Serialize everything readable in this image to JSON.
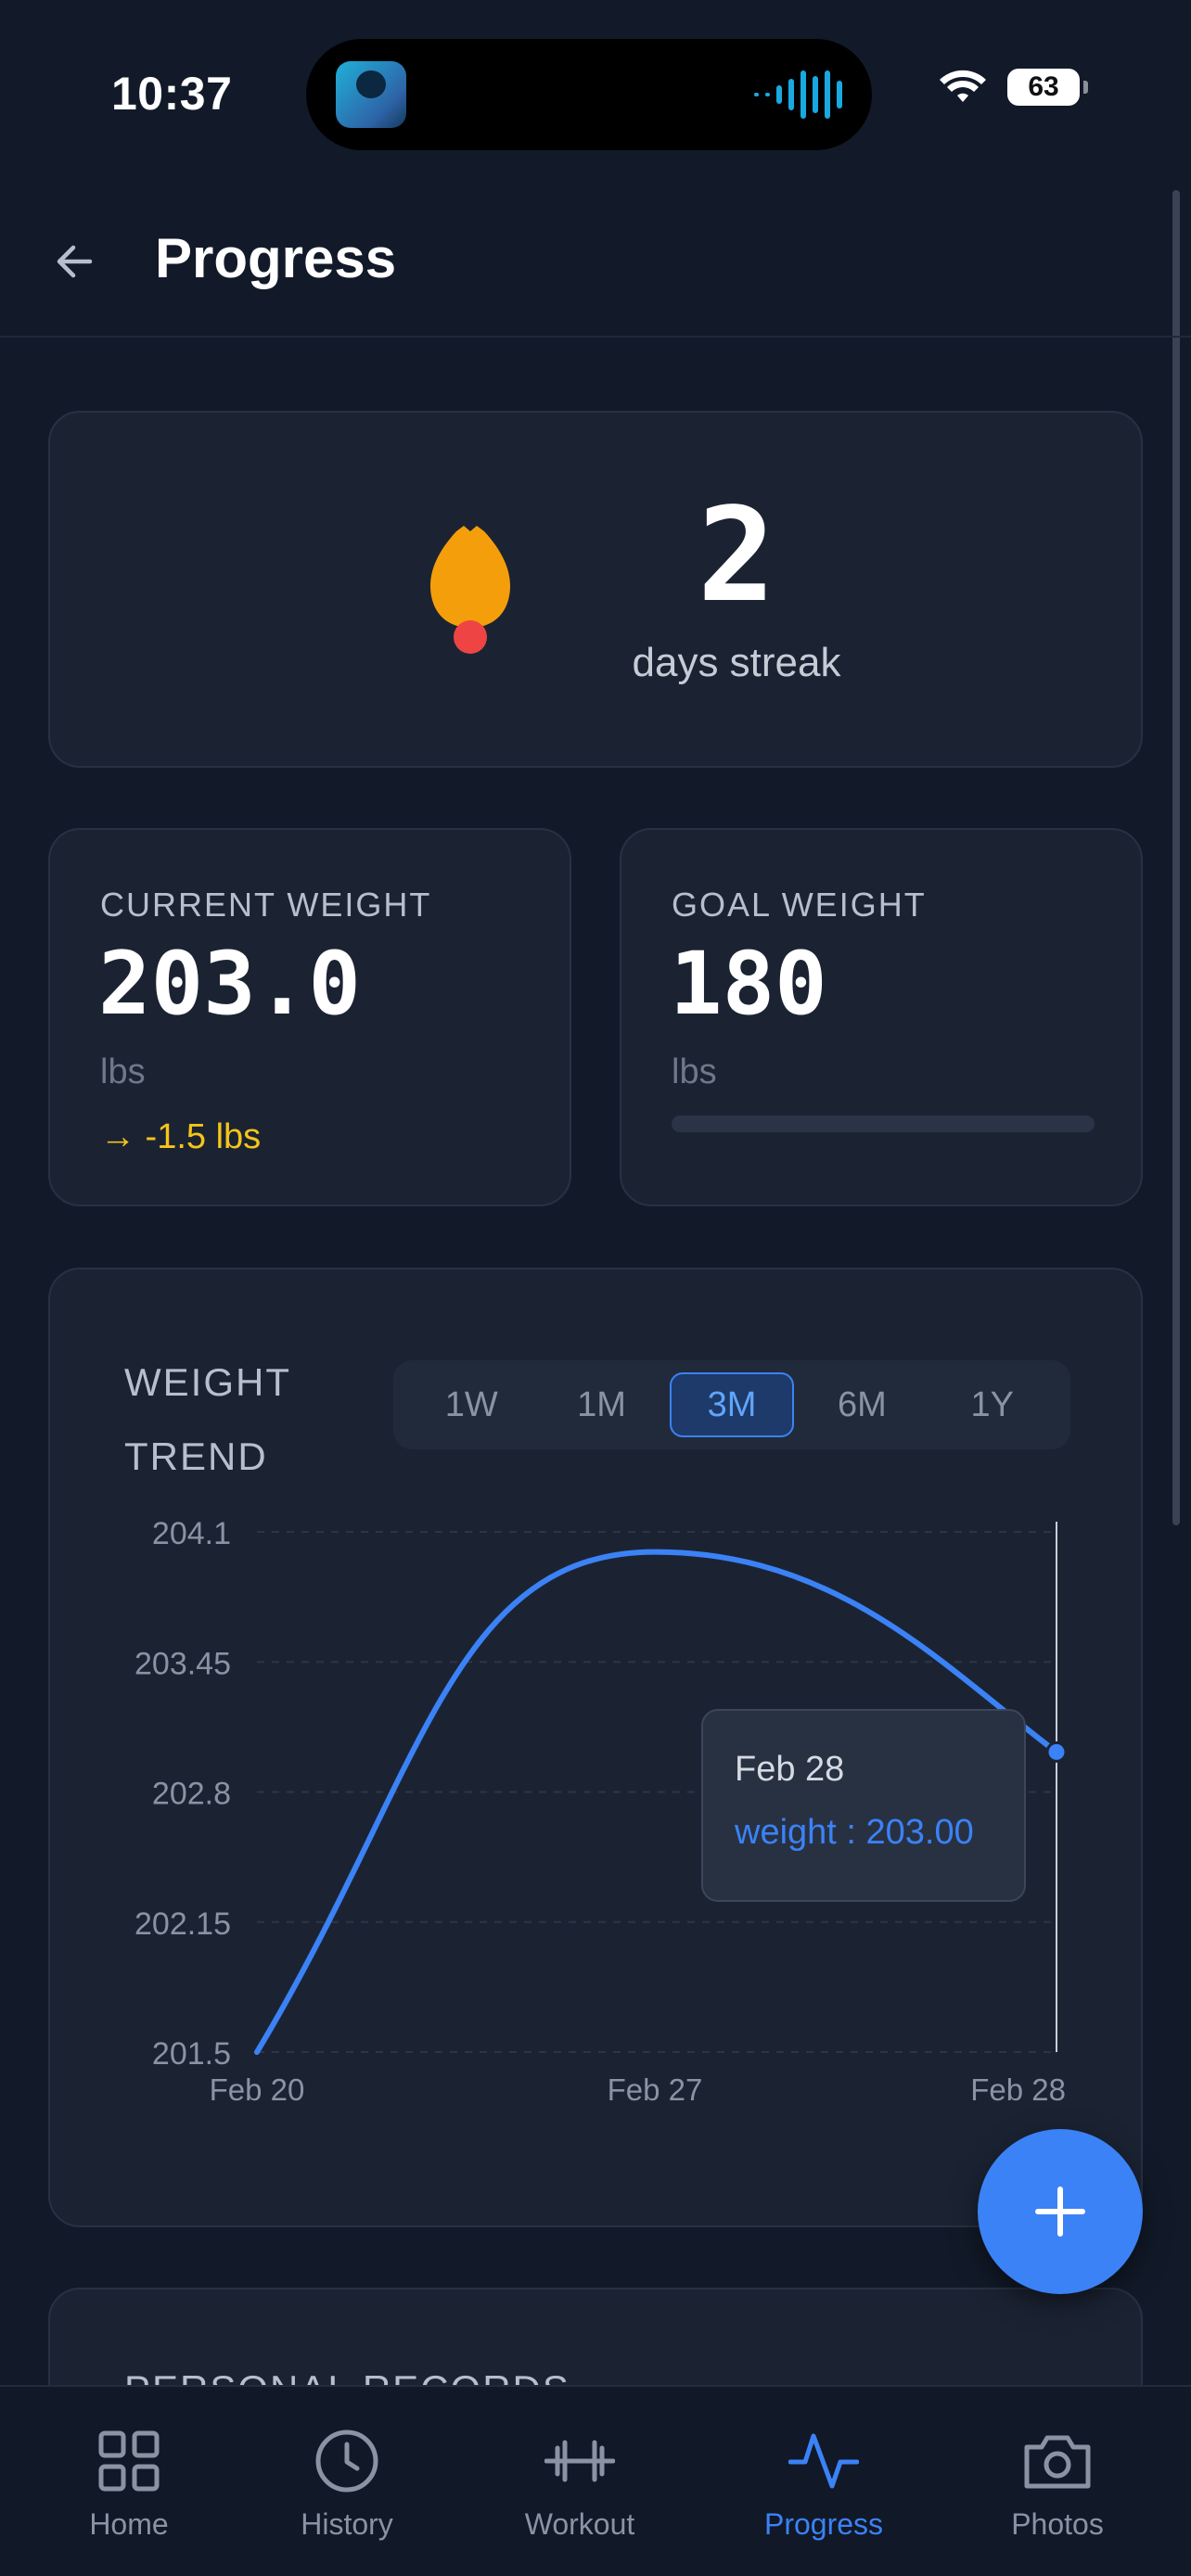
{
  "status_bar": {
    "time": "10:37",
    "battery": "63",
    "signal_icon": "wifi-icon"
  },
  "header": {
    "title": "Progress",
    "back_icon": "arrow-left-icon"
  },
  "streak": {
    "value": "2",
    "label": "days streak",
    "icon": "flame-icon"
  },
  "current_weight": {
    "label": "CURRENT WEIGHT",
    "value": "203.0",
    "unit": "lbs",
    "change": "→ -1.5 lbs",
    "change_color": "#f5c518"
  },
  "goal_weight": {
    "label": "GOAL WEIGHT",
    "value": "180",
    "unit": "lbs",
    "progress_fraction": 0
  },
  "weight_trend": {
    "title": "WEIGHT TREND",
    "ranges": [
      "1W",
      "1M",
      "3M",
      "6M",
      "1Y"
    ],
    "active_range": "3M",
    "tooltip": {
      "title": "Feb 28",
      "value": "weight : 203.00"
    }
  },
  "chart_data": {
    "type": "line",
    "title": "",
    "xlabel": "",
    "ylabel": "",
    "x": [
      "Feb 20",
      "Feb 27",
      "Feb 28"
    ],
    "series": [
      {
        "values": [
          201.5,
          204.0,
          203.0
        ]
      }
    ],
    "y_ticks": [
      "204.1",
      "203.45",
      "202.8",
      "202.15",
      "201.5"
    ],
    "ylim": [
      201.5,
      204.1
    ],
    "grid": true,
    "line_color": "#3b82f6",
    "highlighted_point": "Feb 28"
  },
  "personal_records": {
    "title": "PERSONAL RECORDS"
  },
  "fab": {
    "icon": "plus-icon"
  },
  "bottom_nav": {
    "items": [
      {
        "label": "Home",
        "icon": "grid-icon"
      },
      {
        "label": "History",
        "icon": "clock-icon"
      },
      {
        "label": "Workout",
        "icon": "dumbbell-icon"
      },
      {
        "label": "Progress",
        "icon": "activity-icon"
      },
      {
        "label": "Photos",
        "icon": "camera-icon"
      }
    ],
    "active": "Progress",
    "active_color": "#3b82f6"
  }
}
